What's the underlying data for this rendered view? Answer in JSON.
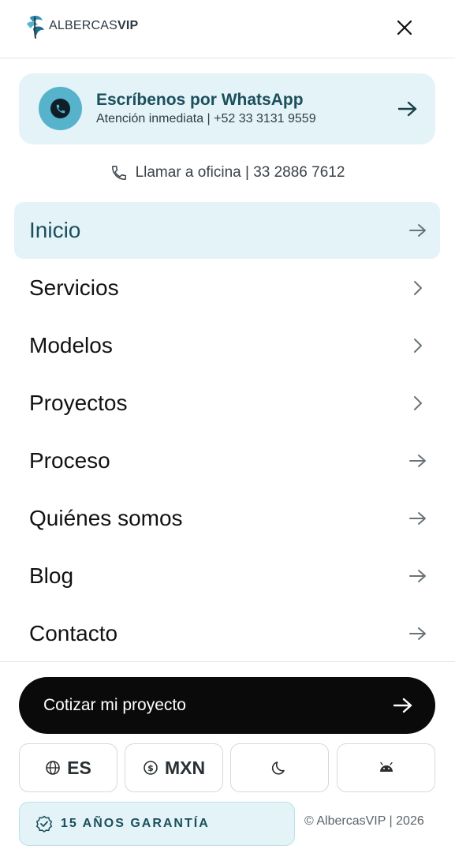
{
  "header": {
    "logo_prefix": "ALBERCAS",
    "logo_suffix": "VIP"
  },
  "whatsapp": {
    "title": "Escríbenos por WhatsApp",
    "subtitle": "Atención inmediata | +52 33 3131 9559"
  },
  "office": {
    "label": "Llamar a oficina | 33 2886 7612"
  },
  "nav": {
    "items": [
      {
        "label": "Inicio",
        "icon": "arrow-right-icon",
        "active": true
      },
      {
        "label": "Servicios",
        "icon": "chevron-right-icon"
      },
      {
        "label": "Modelos",
        "icon": "chevron-right-icon"
      },
      {
        "label": "Proyectos",
        "icon": "chevron-right-icon"
      },
      {
        "label": "Proceso",
        "icon": "arrow-right-icon"
      },
      {
        "label": "Quiénes somos",
        "icon": "arrow-right-icon"
      },
      {
        "label": "Blog",
        "icon": "arrow-right-icon"
      },
      {
        "label": "Contacto",
        "icon": "arrow-right-icon"
      }
    ]
  },
  "cta": {
    "label": "Cotizar mi proyecto"
  },
  "settings": {
    "language": "ES",
    "currency": "MXN",
    "theme_icon": "moon-icon",
    "app_icon": "android-icon"
  },
  "badge": {
    "label": "15 AÑOS GARANTÍA"
  },
  "footer": {
    "copyright": "© AlbercasVIP | 2026"
  },
  "colors": {
    "accent_bg": "#e3f3f8",
    "accent_text": "#1b4f5b",
    "whatsapp_circle": "#56b3cb",
    "cta_bg": "#0a0a0a"
  }
}
